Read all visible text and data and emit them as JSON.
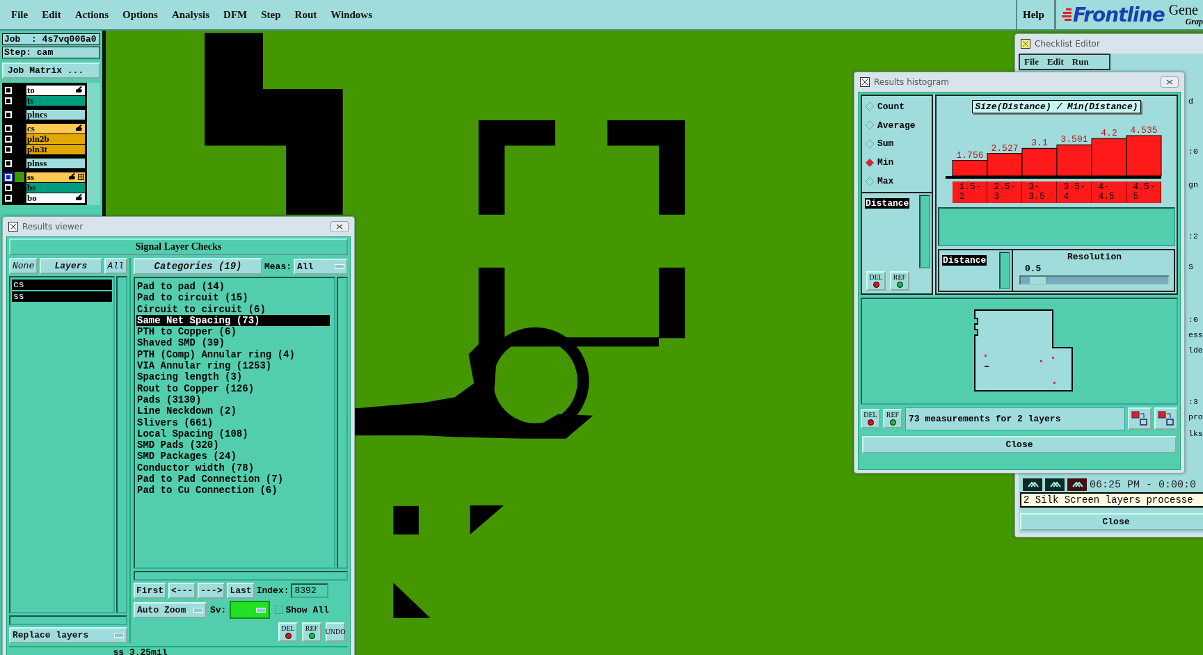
{
  "menubar": {
    "items": [
      "File",
      "Edit",
      "Actions",
      "Options",
      "Analysis",
      "DFM",
      "Step",
      "Rout",
      "Windows"
    ],
    "help": "Help",
    "logo": "Frontline",
    "title_fragment": "Gene",
    "subtitle_fragment": "Grap"
  },
  "job_panel": {
    "job": "Job  : 4s7vq006a0",
    "step": "Step: cam",
    "matrix_button": "Job Matrix ...",
    "layer_groups": [
      [
        {
          "name": "to",
          "color": "#ffffff",
          "affected": true,
          "active": false
        },
        {
          "name": "ts",
          "color": "#009c80",
          "affected": false,
          "active": false
        }
      ],
      [
        {
          "name": "plncs",
          "color": "#a0dcdc",
          "affected": false,
          "active": false
        }
      ],
      [
        {
          "name": "cs",
          "color": "#ffc850",
          "affected": true,
          "active": false
        },
        {
          "name": "pln2b",
          "color": "#e0a800",
          "affected": false,
          "active": false
        },
        {
          "name": "pln3t",
          "color": "#e0a800",
          "affected": false,
          "active": false
        }
      ],
      [
        {
          "name": "plnss",
          "color": "#a0dcdc",
          "affected": false,
          "active": false
        }
      ],
      [
        {
          "name": "ss",
          "color": "#ffc850",
          "affected": true,
          "active": true
        },
        {
          "name": "bs",
          "color": "#009c80",
          "affected": false,
          "active": false
        },
        {
          "name": "bo",
          "color": "#ffffff",
          "affected": true,
          "active": false
        }
      ]
    ]
  },
  "results_viewer": {
    "title": "Results viewer",
    "header": "Signal Layer Checks",
    "layer_buttons": [
      "None",
      "Layers",
      "All"
    ],
    "layers": [
      {
        "name": "cs",
        "selected": true
      },
      {
        "name": "ss",
        "selected": true
      }
    ],
    "categories_header": "Categories (19)",
    "meas_label": "Meas:",
    "meas_value": "All",
    "categories": [
      {
        "label": "Pad to pad (14)",
        "selected": false
      },
      {
        "label": "Pad to circuit (15)",
        "selected": false
      },
      {
        "label": "Circuit to circuit (6)",
        "selected": false
      },
      {
        "label": "Same Net Spacing (73)",
        "selected": true
      },
      {
        "label": "PTH to Copper (6)",
        "selected": false
      },
      {
        "label": "Shaved SMD (39)",
        "selected": false
      },
      {
        "label": "PTH (Comp) Annular ring (4)",
        "selected": false
      },
      {
        "label": "VIA Annular ring (1253)",
        "selected": false
      },
      {
        "label": "Spacing length (3)",
        "selected": false
      },
      {
        "label": "Rout to Copper (126)",
        "selected": false
      },
      {
        "label": "Pads (3130)",
        "selected": false
      },
      {
        "label": "Line Neckdown (2)",
        "selected": false
      },
      {
        "label": "Slivers (661)",
        "selected": false
      },
      {
        "label": "Local Spacing (108)",
        "selected": false
      },
      {
        "label": "SMD Pads (320)",
        "selected": false
      },
      {
        "label": "SMD Packages (24)",
        "selected": false
      },
      {
        "label": "Conductor width (78)",
        "selected": false
      },
      {
        "label": "Pad to Pad Connection (7)",
        "selected": false
      },
      {
        "label": "Pad to Cu Connection (6)",
        "selected": false
      }
    ],
    "nav_buttons": [
      "First",
      "<---",
      "--->",
      "Last"
    ],
    "index_label": "Index:",
    "index_value": "8392",
    "zoom_mode": "Auto Zoom",
    "sv_label": "Sv:",
    "show_all": {
      "label": "Show All",
      "checked": false
    },
    "replace_mode": "Replace layers",
    "tool_buttons": [
      "DEL",
      "REF",
      "UNDO"
    ],
    "status": "ss 3.25mil"
  },
  "results_histogram": {
    "title": "Results histogram",
    "functions": [
      {
        "label": "Count",
        "selected": false
      },
      {
        "label": "Average",
        "selected": false
      },
      {
        "label": "Sum",
        "selected": false
      },
      {
        "label": "Min",
        "selected": true
      },
      {
        "label": "Max",
        "selected": false
      }
    ],
    "attributes": [
      {
        "label": "Distance",
        "selected": true
      }
    ],
    "list_tool_buttons": [
      "DEL",
      "REF"
    ],
    "chart_data": {
      "type": "bar",
      "title": "Size(Distance) / Min(Distance)",
      "categories": [
        "1.5-2",
        "2.5-3",
        "3-3.5",
        "3.5-4",
        "4-4.5",
        "4.5-5"
      ],
      "values": [
        1.756,
        2.527,
        3.1,
        3.501,
        4.2,
        4.535
      ],
      "data_labels": true
    },
    "secondary_attributes": [
      {
        "label": "Distance",
        "selected": true
      }
    ],
    "resolution_label": "Resolution",
    "resolution_value": "0.5",
    "resolution_slider": {
      "level": 0.06
    },
    "tool_buttons": [
      "DEL",
      "REF"
    ],
    "summary": "73 measurements for 2 layers",
    "close": "Close"
  },
  "checklist_editor": {
    "title": "Checklist Editor",
    "menu": [
      "File",
      "Edit",
      "Run"
    ],
    "partial_lines": [
      "d",
      ":0",
      "gn",
      ":2",
      "S",
      ":0",
      "ess",
      "lde",
      ":3",
      "pro",
      "lks"
    ],
    "time": "06:25 PM - 0:00:0",
    "message": "2 Silk Screen layers processe",
    "close": "Close"
  }
}
